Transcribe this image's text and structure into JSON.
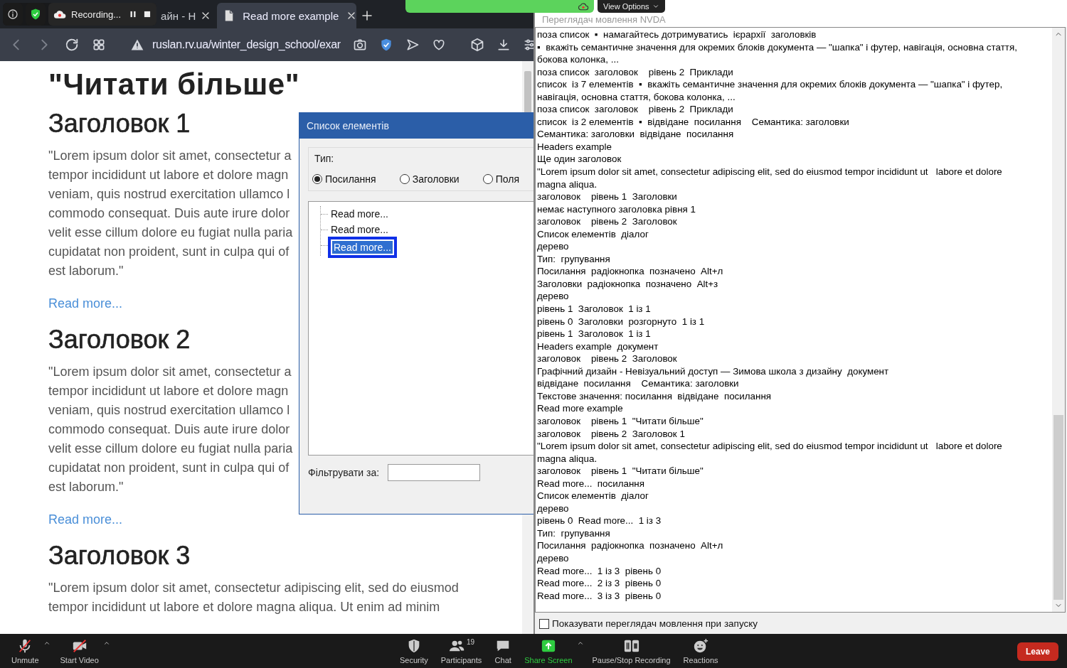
{
  "browser": {
    "tabs": [
      {
        "label": "айн - Н",
        "selected": false
      },
      {
        "label": "Read more example",
        "selected": true
      }
    ],
    "url": "ruslan.rv.ua/winter_design_school/exar"
  },
  "recording_indicator": {
    "label": "Recording..."
  },
  "share_banner": {
    "button": "View Options"
  },
  "page": {
    "title": "\"Читати більше\"",
    "sections": [
      {
        "heading": "Заголовок 1",
        "lines": [
          "\"Lorem ipsum dolor sit amet, consectetur a",
          "tempor incididunt ut labore et dolore magn",
          "veniam, quis nostrud exercitation ullamco l",
          "commodo consequat. Duis aute irure dolor",
          "velit esse cillum dolore eu fugiat nulla paria",
          "cupidatat non proident, sunt in culpa qui of",
          "est laborum.\""
        ],
        "link": "Read more..."
      },
      {
        "heading": "Заголовок 2",
        "lines": [
          "\"Lorem ipsum dolor sit amet, consectetur a",
          "tempor incididunt ut labore et dolore magn",
          "veniam, quis nostrud exercitation ullamco l",
          "commodo consequat. Duis aute irure dolor",
          "velit esse cillum dolore eu fugiat nulla paria",
          "cupidatat non proident, sunt in culpa qui of",
          "est laborum.\""
        ],
        "link": "Read more..."
      },
      {
        "heading": "Заголовок 3",
        "lines": [
          "\"Lorem ipsum dolor sit amet, consectetur adipiscing elit, sed do eiusmod",
          "tempor incididunt ut labore et dolore magna aliqua. Ut enim ad minim"
        ]
      }
    ]
  },
  "dialog": {
    "title": "Список елементів",
    "group_label": "Тип:",
    "radios": [
      {
        "label": "Посилання",
        "selected": true
      },
      {
        "label": "Заголовки",
        "selected": false
      },
      {
        "label": "Поля",
        "selected": false
      }
    ],
    "tree": [
      {
        "label": "Read more...",
        "selected": false
      },
      {
        "label": "Read more...",
        "selected": false
      },
      {
        "label": "Read more...",
        "selected": true
      }
    ],
    "filter_label": "Фільтрувати за:"
  },
  "speech_viewer": {
    "title": "Переглядач мовлення NVDA",
    "lines": [
      "поза список  ▪  намагайтесь дотримуватись  ієрархії  заголовків",
      "▪  вкажіть семантичне значення для окремих блоків документа — \"шапка\" і футер, навігація, основна стаття,",
      "бокова колонка, ...",
      "поза список  заголовок    рівень 2  Приклади",
      "список  із 7 елементів  ▪  вкажіть семантичне значення для окремих блоків документа — \"шапка\" і футер,",
      "навігація, основна стаття, бокова колонка, ...",
      "поза список  заголовок    рівень 2  Приклади",
      "список  із 2 елементів  ▪  відвідане  посилання    Семантика: заголовки",
      "Семантика: заголовки  відвідане  посилання",
      "Headers example",
      "Ще один заголовок",
      "\"Lorem ipsum dolor sit amet, consectetur adipiscing elit, sed do eiusmod tempor incididunt ut   labore et dolore",
      "magna aliqua.",
      "заголовок    рівень 1  Заголовки",
      "немає наступного заголовка рівня 1",
      "заголовок    рівень 2  Заголовок",
      "Список елементів  діалог",
      "дерево",
      "Тип:  групування",
      "Посилання  радіокнопка  позначено  Alt+л",
      "Заголовки  радіокнопка  позначено  Alt+з",
      "дерево",
      "рівень 1  Заголовок  1 із 1",
      "рівень 0  Заголовки  розгорнуто  1 із 1",
      "рівень 1  Заголовок  1 із 1",
      "Headers example  документ",
      "заголовок    рівень 2  Заголовок",
      "Графічний дизайн - Невізуальний доступ — Зимова школа з дизайну  документ",
      "відвідане  посилання    Семантика: заголовки",
      "Текстове значення: посилання  відвідане  посилання",
      "Read more example",
      "заголовок    рівень 1  \"Читати більше\"",
      "заголовок    рівень 2  Заголовок 1",
      "\"Lorem ipsum dolor sit amet, consectetur adipiscing elit, sed do eiusmod tempor incididunt ut   labore et dolore",
      "magna aliqua.",
      "заголовок    рівень 1  \"Читати більше\"",
      "Read more...  посилання",
      "Список елементів  діалог",
      "дерево",
      "рівень 0  Read more...  1 із 3",
      "Тип:  групування",
      "Посилання  радіокнопка  позначено  Alt+л",
      "дерево",
      "Read more...  1 із 3  рівень 0",
      "Read more...  2 із 3  рівень 0",
      "Read more...  3 із 3  рівень 0"
    ],
    "startup_checkbox": {
      "label": "Показувати переглядач мовлення при запуску",
      "checked": false
    }
  },
  "meeting_toolbar": {
    "items": [
      {
        "label": "Unmute",
        "kind": "mic"
      },
      {
        "label": "Start Video",
        "kind": "video"
      },
      {
        "label": "Security",
        "kind": "security"
      },
      {
        "label": "Participants",
        "kind": "participants",
        "count": "19"
      },
      {
        "label": "Chat",
        "kind": "chat"
      },
      {
        "label": "Share Screen",
        "kind": "share"
      },
      {
        "label": "Pause/Stop Recording",
        "kind": "recording"
      },
      {
        "label": "Reactions",
        "kind": "reactions"
      }
    ],
    "leave": "Leave"
  }
}
